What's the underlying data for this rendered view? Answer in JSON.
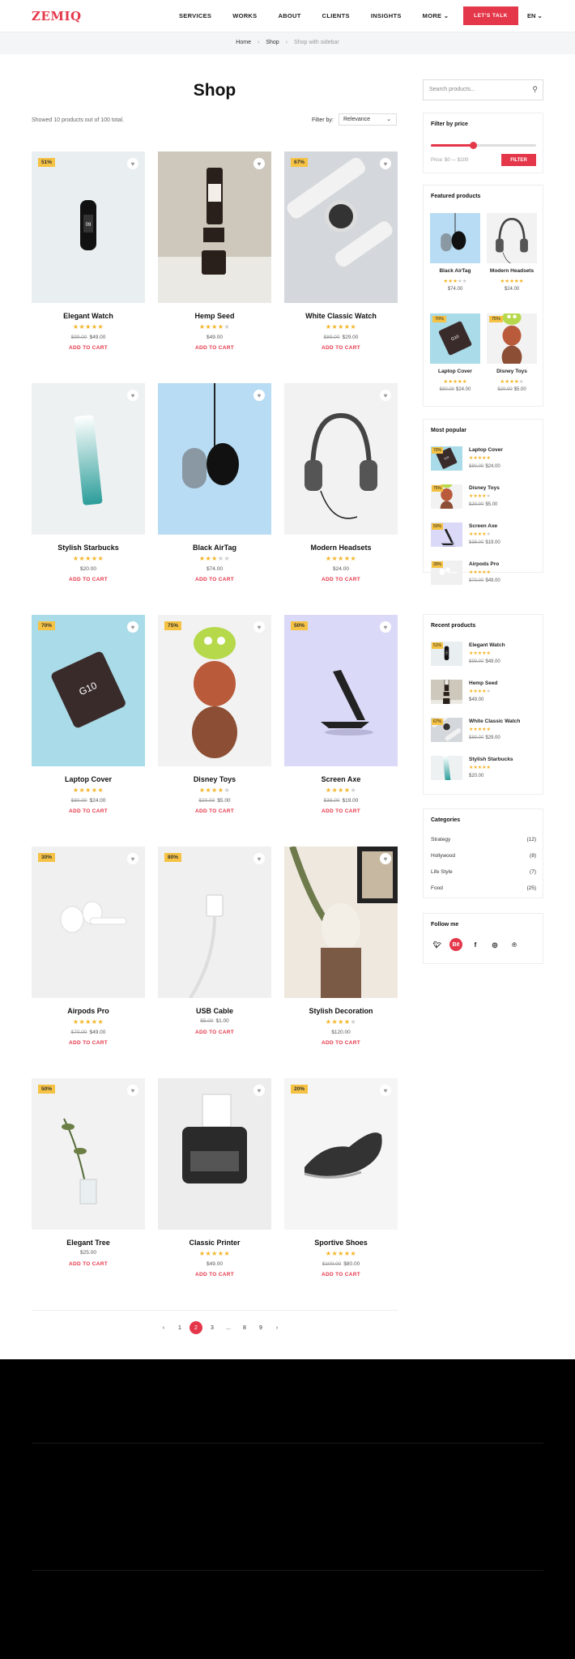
{
  "header": {
    "logo": "ZEMIQ",
    "nav": [
      "SERVICES",
      "WORKS",
      "ABOUT",
      "CLIENTS",
      "INSIGHTS",
      "MORE"
    ],
    "cta": "LET'S TALK",
    "lang": "EN"
  },
  "breadcrumb": {
    "home": "Home",
    "shop": "Shop",
    "current": "Shop with sidebar"
  },
  "main": {
    "title": "Shop",
    "showed": "Showed 10 products out of 100 total.",
    "filter_label": "Filter by:",
    "sort_value": "Relevance"
  },
  "products": [
    {
      "name": "Elegant Watch",
      "badge": "51%",
      "rating": 5,
      "old_price": "$99.00",
      "price": "$49.00",
      "add": "ADD TO CART"
    },
    {
      "name": "Hemp Seed",
      "badge": "",
      "rating": 4,
      "old_price": "",
      "price": "$49.00",
      "add": "ADD TO CART"
    },
    {
      "name": "White Classic Watch",
      "badge": "67%",
      "rating": 5,
      "old_price": "$89.00",
      "price": "$29.00",
      "add": "ADD TO CART"
    },
    {
      "name": "Stylish Starbucks",
      "badge": "",
      "rating": 5,
      "old_price": "",
      "price": "$20.00",
      "add": "ADD TO CART"
    },
    {
      "name": "Black AirTag",
      "badge": "",
      "rating": 3,
      "old_price": "",
      "price": "$74.00",
      "add": "ADD TO CART"
    },
    {
      "name": "Modern Headsets",
      "badge": "",
      "rating": 5,
      "old_price": "",
      "price": "$24.00",
      "add": "ADD TO CART"
    },
    {
      "name": "Laptop Cover",
      "badge": "70%",
      "rating": 5,
      "old_price": "$80.00",
      "price": "$24.00",
      "add": "ADD TO CART"
    },
    {
      "name": "Disney Toys",
      "badge": "75%",
      "rating": 4,
      "old_price": "$20.00",
      "price": "$5.00",
      "add": "ADD TO CART"
    },
    {
      "name": "Screen Axe",
      "badge": "50%",
      "rating": 4,
      "old_price": "$38.00",
      "price": "$19.00",
      "add": "ADD TO CART"
    },
    {
      "name": "Airpods Pro",
      "badge": "30%",
      "rating": 5,
      "old_price": "$70.00",
      "price": "$49.00",
      "add": "ADD TO CART"
    },
    {
      "name": "USB Cable",
      "badge": "80%",
      "rating": 0,
      "old_price": "$5.00",
      "price": "$1.00",
      "add": "ADD TO CART"
    },
    {
      "name": "Stylish Decoration",
      "badge": "",
      "rating": 4,
      "old_price": "",
      "price": "$120.00",
      "add": "ADD TO CART"
    },
    {
      "name": "Elegant Tree",
      "badge": "50%",
      "rating": 0,
      "old_price": "",
      "price": "$25.00",
      "add": "ADD TO CART"
    },
    {
      "name": "Classic Printer",
      "badge": "",
      "rating": 5,
      "old_price": "",
      "price": "$49.00",
      "add": "ADD TO CART"
    },
    {
      "name": "Sportive Shoes",
      "badge": "20%",
      "rating": 5,
      "old_price": "$100.00",
      "price": "$80.00",
      "add": "ADD TO CART"
    }
  ],
  "pagination": {
    "prev": "‹",
    "pages": [
      "1",
      "2",
      "3",
      "...",
      "8",
      "9"
    ],
    "active": "2",
    "next": "›"
  },
  "sidebar": {
    "search_placeholder": "Search products...",
    "price_filter": {
      "title": "Filter by price",
      "range": "Price: $0 — $100",
      "button": "FILTER",
      "level": 0.4
    },
    "featured": {
      "title": "Featured products",
      "items": [
        {
          "name": "Black AirTag",
          "badge": "",
          "rating": 3,
          "old_price": "",
          "price": "$74.00"
        },
        {
          "name": "Modern Headsets",
          "badge": "",
          "rating": 5,
          "old_price": "",
          "price": "$24.00"
        },
        {
          "name": "Laptop Cover",
          "badge": "70%",
          "rating": 5,
          "old_price": "$80.00",
          "price": "$24.00"
        },
        {
          "name": "Disney Toys",
          "badge": "75%",
          "rating": 4,
          "old_price": "$20.00",
          "price": "$5.00"
        }
      ]
    },
    "popular": {
      "title": "Most popular",
      "items": [
        {
          "name": "Laptop Cover",
          "badge": "70%",
          "rating": 5,
          "old_price": "$80.00",
          "price": "$24.00"
        },
        {
          "name": "Disney Toys",
          "badge": "75%",
          "rating": 4,
          "old_price": "$20.00",
          "price": "$5.00"
        },
        {
          "name": "Screen Axe",
          "badge": "50%",
          "rating": 4,
          "old_price": "$38.00",
          "price": "$19.00"
        },
        {
          "name": "Airpods Pro",
          "badge": "30%",
          "rating": 5,
          "old_price": "$70.00",
          "price": "$49.00"
        }
      ]
    },
    "recent": {
      "title": "Recent products",
      "items": [
        {
          "name": "Elegant Watch",
          "badge": "51%",
          "rating": 5,
          "old_price": "$99.00",
          "price": "$49.00"
        },
        {
          "name": "Hemp Seed",
          "badge": "",
          "rating": 4,
          "old_price": "",
          "price": "$49.00"
        },
        {
          "name": "White Classic Watch",
          "badge": "67%",
          "rating": 5,
          "old_price": "$89.00",
          "price": "$29.00"
        },
        {
          "name": "Stylish Starbucks",
          "badge": "",
          "rating": 5,
          "old_price": "",
          "price": "$20.00"
        }
      ]
    },
    "categories": {
      "title": "Categories",
      "items": [
        {
          "name": "Strategy",
          "count": "(12)"
        },
        {
          "name": "Hollywood",
          "count": "(8)"
        },
        {
          "name": "Life Style",
          "count": "(7)"
        },
        {
          "name": "Food",
          "count": "(25)"
        }
      ]
    },
    "follow": {
      "title": "Follow me",
      "icons": [
        "twitter-icon",
        "behance-icon",
        "facebook-icon",
        "instagram-icon",
        "pinterest-icon"
      ]
    }
  },
  "colors": {
    "accent": "#e5374a",
    "badge": "#f5c243",
    "star": "#f4b324"
  }
}
